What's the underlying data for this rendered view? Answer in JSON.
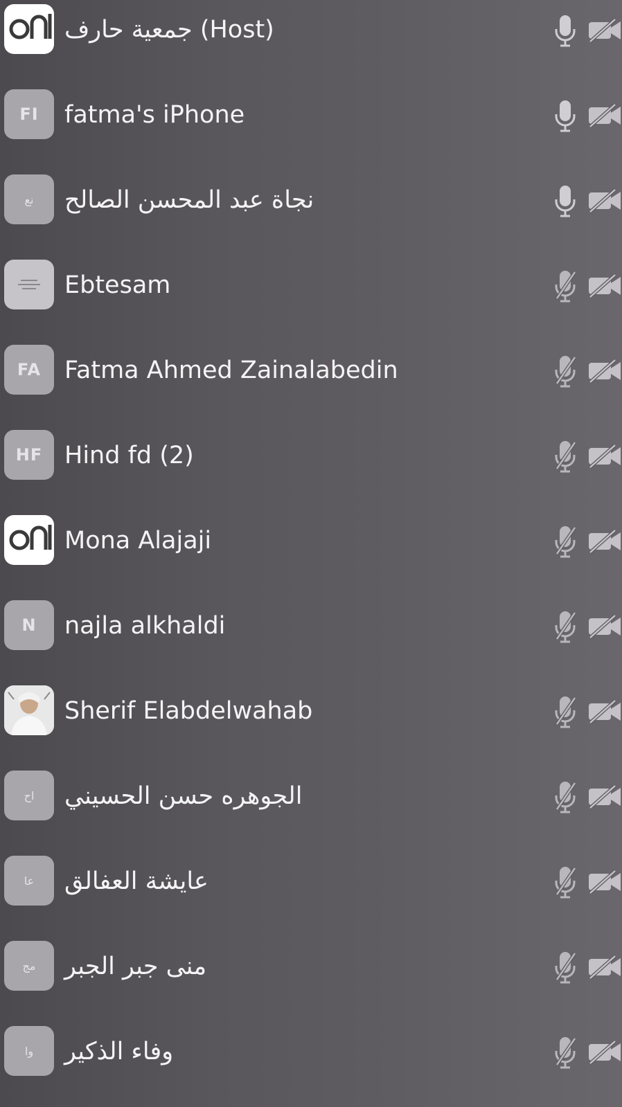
{
  "participants": [
    {
      "name": "جمعية حارف (Host)",
      "avatar": {
        "type": "logo",
        "text": ""
      },
      "mic": "on",
      "video": "off"
    },
    {
      "name": "fatma's iPhone",
      "avatar": {
        "type": "initials",
        "text": "FI"
      },
      "mic": "on",
      "video": "off"
    },
    {
      "name": "نجاة عبد المحسن الصالح",
      "avatar": {
        "type": "initials",
        "text": "نع"
      },
      "mic": "on",
      "video": "off"
    },
    {
      "name": "Ebtesam",
      "avatar": {
        "type": "logo-text",
        "text": ""
      },
      "mic": "muted",
      "video": "off"
    },
    {
      "name": "Fatma Ahmed Zainalabedin",
      "avatar": {
        "type": "initials",
        "text": "FA"
      },
      "mic": "muted",
      "video": "off"
    },
    {
      "name": "Hind fd (2)",
      "avatar": {
        "type": "initials",
        "text": "HF"
      },
      "mic": "muted",
      "video": "off"
    },
    {
      "name": "Mona Alajaji",
      "avatar": {
        "type": "logo",
        "text": ""
      },
      "mic": "muted",
      "video": "off"
    },
    {
      "name": "najla alkhaldi",
      "avatar": {
        "type": "initials",
        "text": "N"
      },
      "mic": "muted",
      "video": "off"
    },
    {
      "name": "Sherif Elabdelwahab",
      "avatar": {
        "type": "photo",
        "text": ""
      },
      "mic": "muted",
      "video": "off"
    },
    {
      "name": "الجوهره حسن الحسيني",
      "avatar": {
        "type": "initials",
        "text": "اح"
      },
      "mic": "muted",
      "video": "off"
    },
    {
      "name": "عايشة العفالق",
      "avatar": {
        "type": "initials",
        "text": "عا"
      },
      "mic": "muted",
      "video": "off"
    },
    {
      "name": "منى جبر الجبر",
      "avatar": {
        "type": "initials",
        "text": "مج"
      },
      "mic": "muted",
      "video": "off"
    },
    {
      "name": "وفاء الذكير",
      "avatar": {
        "type": "initials",
        "text": "وا"
      },
      "mic": "muted",
      "video": "off"
    }
  ],
  "icons": {
    "mic_on": "microphone-icon",
    "mic_off": "microphone-muted-icon",
    "video_off": "video-off-icon"
  },
  "colors": {
    "background": "#5a575c",
    "text": "#f4f4f6",
    "icon": "#c9c7cb",
    "avatar": "#a8a6aa"
  }
}
